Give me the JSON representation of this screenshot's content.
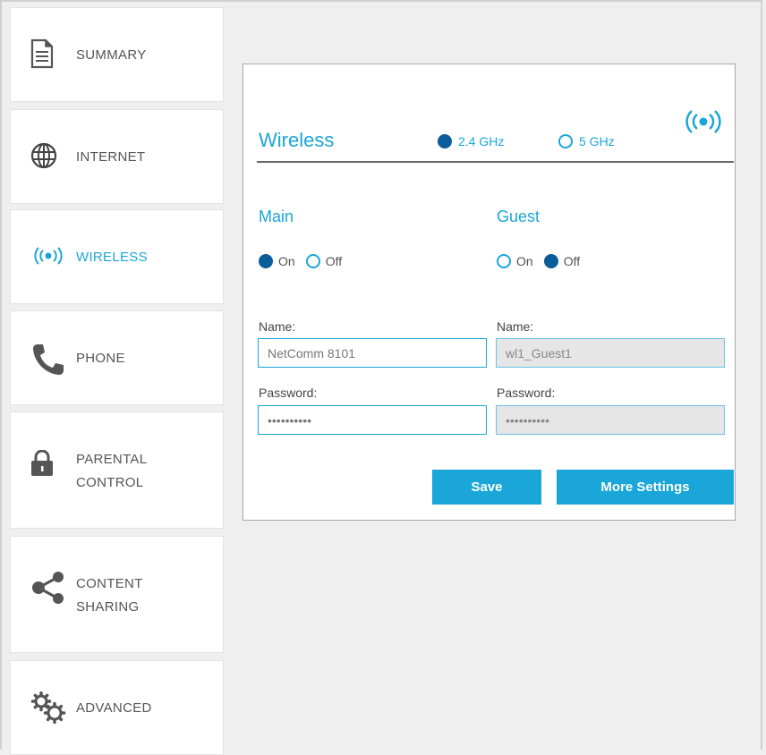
{
  "sidebar": {
    "items": [
      {
        "label": "SUMMARY",
        "icon": "document-icon"
      },
      {
        "label": "INTERNET",
        "icon": "globe-icon"
      },
      {
        "label": "WIRELESS",
        "icon": "wireless-icon",
        "active": true
      },
      {
        "label": "PHONE",
        "icon": "phone-icon"
      },
      {
        "label": "PARENTAL",
        "label2": "CONTROL",
        "icon": "lock-icon"
      },
      {
        "label": "CONTENT",
        "label2": "SHARING",
        "icon": "share-icon"
      },
      {
        "label": "ADVANCED",
        "icon": "gears-icon"
      }
    ]
  },
  "panel": {
    "title": "Wireless",
    "bands": [
      {
        "label": "2.4 GHz",
        "selected": true
      },
      {
        "label": "5 GHz",
        "selected": false
      }
    ],
    "main": {
      "title": "Main",
      "on_label": "On",
      "off_label": "Off",
      "state": "on",
      "name_label": "Name:",
      "name_value": "NetComm 8101",
      "password_label": "Password:",
      "password_value": "••••••••••"
    },
    "guest": {
      "title": "Guest",
      "on_label": "On",
      "off_label": "Off",
      "state": "off",
      "name_label": "Name:",
      "name_value": "wl1_Guest1",
      "password_label": "Password:",
      "password_value": "••••••••••"
    },
    "save_label": "Save",
    "more_settings_label": "More Settings"
  },
  "colors": {
    "accent": "#1aa6d8",
    "radio_selected": "#0a5c9a",
    "background": "#efefef"
  }
}
